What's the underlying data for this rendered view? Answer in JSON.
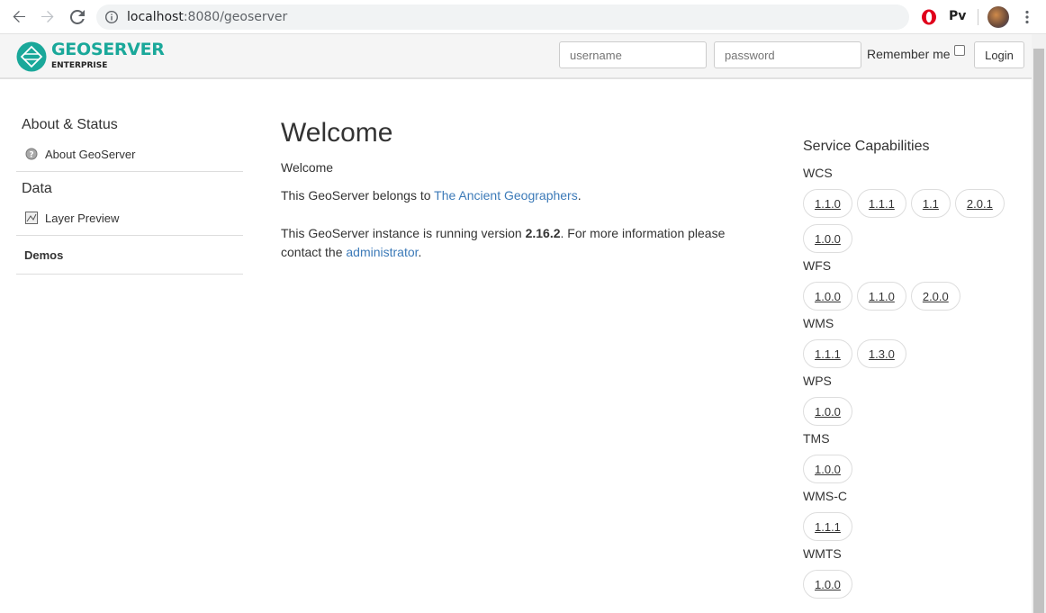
{
  "browser": {
    "url_host": "localhost",
    "url_path": ":8080/geoserver",
    "extension_pv": "Pv"
  },
  "header": {
    "logo_text": "GEOSERVER",
    "logo_sub": "ENTERPRISE",
    "username_placeholder": "username",
    "password_placeholder": "password",
    "remember_label": "Remember me",
    "login_label": "Login"
  },
  "sidebar": {
    "sections": [
      {
        "title": "About & Status",
        "items": [
          {
            "label": "About GeoServer",
            "icon": "about-icon"
          }
        ]
      },
      {
        "title": "Data",
        "items": [
          {
            "label": "Layer Preview",
            "icon": "layer-preview-icon"
          }
        ]
      }
    ],
    "demos": "Demos"
  },
  "main": {
    "title": "Welcome",
    "subtitle": "Welcome",
    "belongs_prefix": "This GeoServer belongs to ",
    "belongs_link": "The Ancient Geographers",
    "belongs_suffix": ".",
    "version_prefix": "This GeoServer instance is running version ",
    "version": "2.16.2",
    "version_suffix": ". For more information please contact the ",
    "admin_link": "administrator",
    "admin_suffix": "."
  },
  "capabilities": {
    "title": "Service Capabilities",
    "groups": [
      {
        "name": "WCS",
        "versions": [
          "1.1.0",
          "1.1.1",
          "1.1",
          "2.0.1",
          "1.0.0"
        ]
      },
      {
        "name": "WFS",
        "versions": [
          "1.0.0",
          "1.1.0",
          "2.0.0"
        ]
      },
      {
        "name": "WMS",
        "versions": [
          "1.1.1",
          "1.3.0"
        ]
      },
      {
        "name": "WPS",
        "versions": [
          "1.0.0"
        ]
      },
      {
        "name": "TMS",
        "versions": [
          "1.0.0"
        ]
      },
      {
        "name": "WMS-C",
        "versions": [
          "1.1.1"
        ]
      },
      {
        "name": "WMTS",
        "versions": [
          "1.0.0"
        ]
      }
    ]
  },
  "colors": {
    "brand": "#1aa89a",
    "link": "#3c7ab8"
  }
}
